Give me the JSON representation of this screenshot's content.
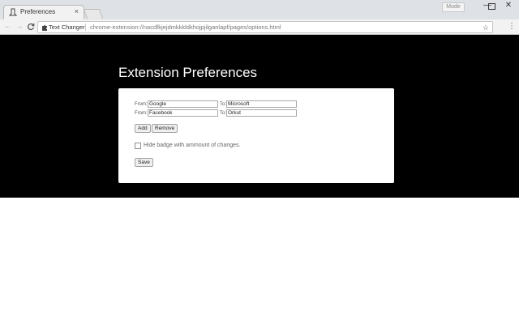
{
  "browser": {
    "tab": {
      "title": "Preferences",
      "favicon": "page-icon",
      "close": "×"
    },
    "user_label": "Mode",
    "window_controls": {
      "minimize": "—",
      "maximize": "☐",
      "close": "✕"
    },
    "nav": {
      "back": "←",
      "forward": "→",
      "reload": "C"
    },
    "omnibox": {
      "extension_icon": "puzzle-icon",
      "extension_name": "Text Changer",
      "url": "chrome-extension://nacdfkjejdmkkkldkhojpjilganlapf/pages/options.html",
      "star": "☆"
    },
    "menu": "⋮"
  },
  "page": {
    "title": "Extension Preferences",
    "rules": [
      {
        "from_label": "From:",
        "from_value": "Google",
        "to_label": "To:",
        "to_value": "Microsoft"
      },
      {
        "from_label": "From:",
        "from_value": "Facebook",
        "to_label": "To:",
        "to_value": "Orkut"
      }
    ],
    "buttons": {
      "add": "Add",
      "remove": "Remove",
      "save": "Save"
    },
    "hide_badge": {
      "label": "Hide badge with ammount of changes.",
      "checked": false
    }
  }
}
